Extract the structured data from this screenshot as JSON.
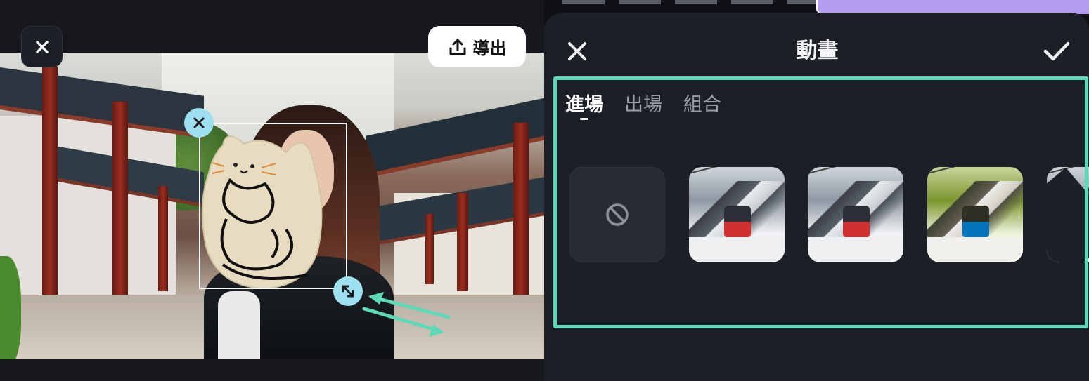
{
  "editor": {
    "export_label": "導出"
  },
  "panel": {
    "title": "動畫",
    "tabs": [
      "進場",
      "出場",
      "組合"
    ],
    "active_tab": "進場",
    "presets": [
      {
        "name": "none",
        "icon": "none-icon"
      },
      {
        "name": "preset-1",
        "icon": "cable-car-thumbnail"
      },
      {
        "name": "preset-2",
        "icon": "cable-car-thumbnail"
      },
      {
        "name": "preset-3",
        "icon": "cable-car-thumbnail-blue"
      },
      {
        "name": "preset-4",
        "icon": "cable-car-thumbnail-partial"
      }
    ]
  },
  "colors": {
    "accent_highlight": "#5ed9b8",
    "handle": "#9fe0f0",
    "panel_bg": "#1c1f26",
    "timeline_clip": "#b59cf0"
  }
}
